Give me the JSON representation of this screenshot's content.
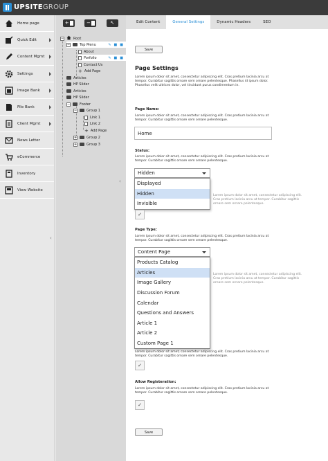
{
  "app": {
    "brand_bold": "UPSITE",
    "brand_light": "GROUP"
  },
  "sidebar": {
    "items": [
      {
        "label": "Home page",
        "icon": "home-icon"
      },
      {
        "label": "Quick Edit",
        "icon": "quick-edit-icon"
      },
      {
        "label": "Content Mgmt",
        "icon": "pencil-icon"
      },
      {
        "label": "Settings",
        "icon": "gear-icon"
      },
      {
        "label": "Image Bank",
        "icon": "image-icon"
      },
      {
        "label": "File Bank",
        "icon": "file-icon"
      },
      {
        "label": "Client Mgmt",
        "icon": "client-icon"
      },
      {
        "label": "News Letter",
        "icon": "newsletter-icon"
      },
      {
        "label": "eCommerce",
        "icon": "cart-icon"
      },
      {
        "label": "Inventory",
        "icon": "inventory-icon"
      },
      {
        "label": "View Website",
        "icon": "website-icon"
      }
    ]
  },
  "tree": {
    "items": [
      {
        "label": "Root"
      },
      {
        "label": "Top Menu"
      },
      {
        "label": "About"
      },
      {
        "label": "Porfolio"
      },
      {
        "label": "Contact Us"
      },
      {
        "label": "Add Page"
      },
      {
        "label": "Articles"
      },
      {
        "label": "HP Slider"
      },
      {
        "label": "Articles"
      },
      {
        "label": "HP Slider"
      },
      {
        "label": "Footer"
      },
      {
        "label": "Group 1"
      },
      {
        "label": "Link 1"
      },
      {
        "label": "Link 2"
      },
      {
        "label": "Add Page"
      },
      {
        "label": "Group 2"
      },
      {
        "label": "Group 3"
      }
    ]
  },
  "tabs": [
    {
      "label": "Edit Content"
    },
    {
      "label": "General Settings"
    },
    {
      "label": "Dynamic Headers"
    },
    {
      "label": "SEO"
    }
  ],
  "main": {
    "save_label": "Save",
    "title": "Page Settings",
    "intro": "Lorem ipsum dolor sit amet, consectetur adipiscing elit. Cras pretium lacinia arcu at tempor. Curabitur sagittis ornare sem ornare pelentesque. Phasellus id ipsum dolor. Phasellus velit ultrices dolor, vel tincidunt purus condimentum in.",
    "page_name_label": "Page Name:",
    "short_desc": "Lorem ipsum dolor sit amet, consectetur adipiscing elit. Cras pretium lacinia arcu at tempor. Curabitur sagittis ornare sem ornare pelentesque.",
    "page_name_value": "Home",
    "status_label": "Status:",
    "status_value": "Hidden",
    "status_options": [
      "Displayed",
      "Hidden",
      "Invisible"
    ],
    "page_type_label": "Page Type:",
    "page_type_value": "Content Page",
    "page_type_options": [
      "Products Catalog",
      "Articles",
      "Image Gallery",
      "Discussion Forum",
      "Calendar",
      "Questions and Answers",
      "Article 1",
      "Article 2",
      "Custom Page 1"
    ],
    "allow_reg_label": "Allow Registeration:",
    "check_glyph": "✓"
  },
  "colors": {
    "accent": "#2a8fd6",
    "highlight": "#cfe0f5",
    "topbar": "#3b3b3b"
  }
}
